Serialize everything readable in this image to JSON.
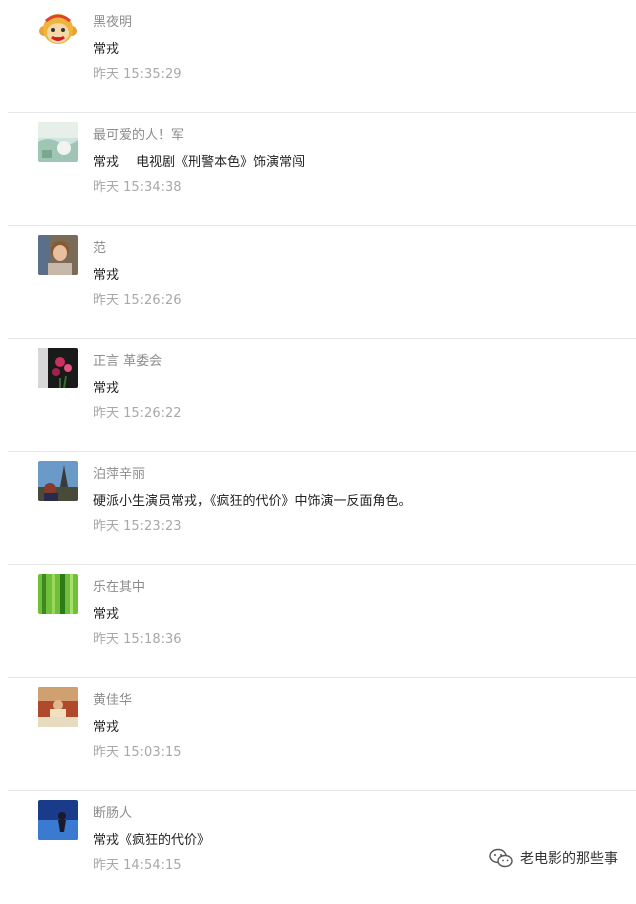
{
  "comments": [
    {
      "nickname": "黑夜明",
      "content": "常戎",
      "time": "昨天 15:35:29",
      "avatar": "monkey-cartoon-avatar"
    },
    {
      "nickname": "最可爱的人！军",
      "content": "常戎　 电视剧《刑警本色》饰演常闯",
      "time": "昨天 15:34:38",
      "avatar": "landscape-photo-avatar"
    },
    {
      "nickname": "范",
      "content": "常戎",
      "time": "昨天 15:26:26",
      "avatar": "portrait-photo-avatar"
    },
    {
      "nickname": "正言 革委会",
      "content": "常戎",
      "time": "昨天 15:26:22",
      "avatar": "flowers-photo-avatar"
    },
    {
      "nickname": "泊萍辛丽",
      "content": "硬派小生演员常戎，《疯狂的代价》中饰演一反面角色。",
      "time": "昨天 15:23:23",
      "avatar": "tower-photo-avatar"
    },
    {
      "nickname": "乐在其中",
      "content": "常戎",
      "time": "昨天 15:18:36",
      "avatar": "bamboo-photo-avatar"
    },
    {
      "nickname": "黄佳华",
      "content": "常戎",
      "time": "昨天 15:03:15",
      "avatar": "dining-photo-avatar"
    },
    {
      "nickname": "断肠人",
      "content": "常戎《疯狂的代价》",
      "time": "昨天 14:54:15",
      "avatar": "blue-sky-photo-avatar"
    }
  ],
  "watermark": {
    "text": "老电影的那些事",
    "icon": "wechat-icon"
  }
}
